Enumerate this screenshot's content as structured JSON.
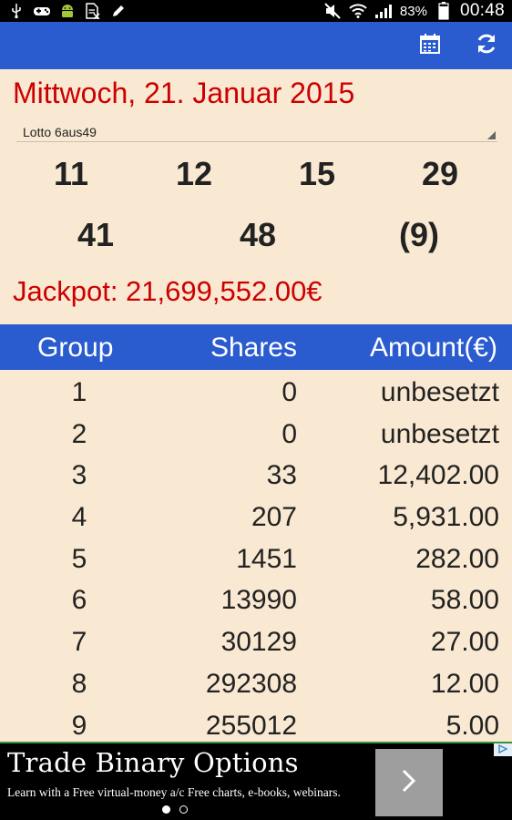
{
  "status_bar": {
    "icons_left": [
      "usb-icon",
      "gamepad-icon",
      "android-icon",
      "file-icon",
      "pencil-icon"
    ],
    "icons_right": [
      "mute-icon",
      "wifi-icon",
      "signal-icon"
    ],
    "battery": "83%",
    "time": "00:48"
  },
  "action_bar": {
    "background": "#2a5ccf",
    "buttons": [
      "calendar-icon",
      "refresh-icon"
    ]
  },
  "date": "Mittwoch, 21. Januar 2015",
  "lottery_select": {
    "selected": "Lotto 6aus49"
  },
  "numbers": [
    "11",
    "12",
    "15",
    "29",
    "41",
    "48",
    "(9)"
  ],
  "jackpot": "Jackpot: 21,699,552.00€",
  "table": {
    "headers": [
      "Group",
      "Shares",
      "Amount(€)"
    ],
    "rows": [
      [
        "1",
        "0",
        "unbesetzt"
      ],
      [
        "2",
        "0",
        "unbesetzt"
      ],
      [
        "3",
        "33",
        "12,402.00"
      ],
      [
        "4",
        "207",
        "5,931.00"
      ],
      [
        "5",
        "1451",
        "282.00"
      ],
      [
        "6",
        "13990",
        "58.00"
      ],
      [
        "7",
        "30129",
        "27.00"
      ],
      [
        "8",
        "292308",
        "12.00"
      ],
      [
        "9",
        "255012",
        "5.00"
      ]
    ]
  },
  "ad": {
    "title": "Trade Binary Options",
    "subtitle": "Learn with a Free virtual-money a/c Free charts, e-books, webinars.",
    "page_indicator": {
      "count": 2,
      "active": 1
    }
  },
  "colors": {
    "accent_red": "#cc0000",
    "background": "#f9e9d2",
    "header_blue": "#2a5ccf"
  }
}
